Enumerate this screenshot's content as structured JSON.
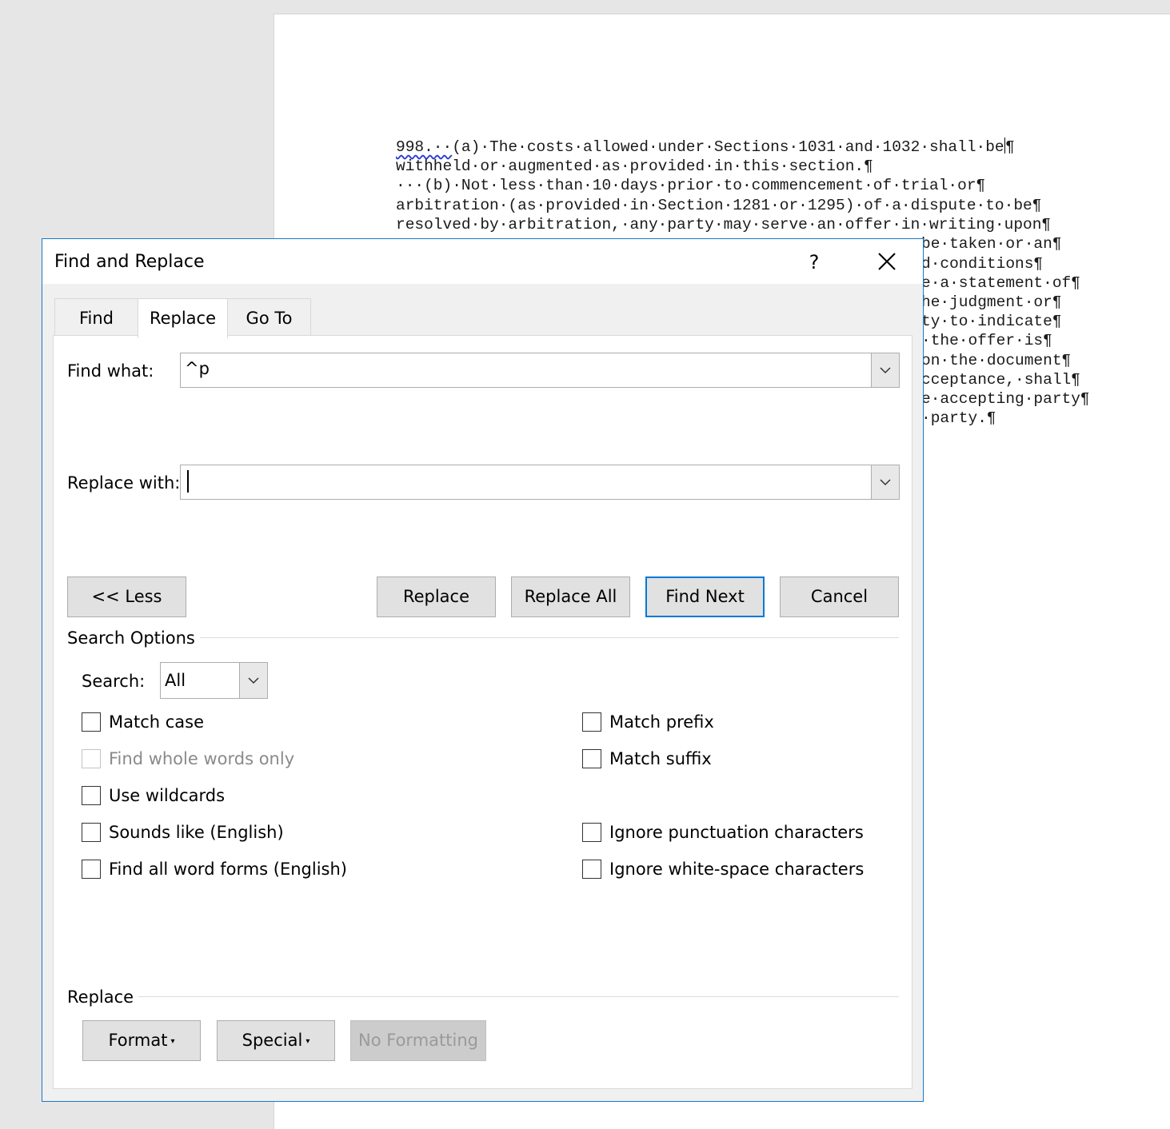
{
  "document": {
    "lines": [
      {
        "pre": "",
        "squiggle": "998.··",
        "post": "(a)·The·costs·allowed·under·Sections·1031·and·1032·shall·be",
        "caret": true,
        "tail": "¶"
      },
      {
        "pre": "withheld·or·augmented·as·provided·in·this·section.¶"
      },
      {
        "pre": "···(b)·Not·less·than·10·days·prior·to·commencement·of·trial·or¶"
      },
      {
        "pre": "arbitration·(as·provided·in·Section·1281·or·1295)·of·a·dispute·to·be¶"
      },
      {
        "pre": "resolved·by·arbitration,·any·party·may·serve·an·offer·in·writing·upon¶"
      },
      {
        "pre": "be·taken·or·an¶"
      },
      {
        "pre": "d·conditions¶"
      },
      {
        "pre": "e·a·statement·of¶"
      },
      {
        "pre": "he·judgment·or¶"
      },
      {
        "pre": "ty·to·indicate¶"
      },
      {
        "pre": "·the·offer·is¶"
      },
      {
        "pre": "on·the·document¶"
      },
      {
        "pre": "cceptance,·shall¶"
      },
      {
        "pre": "e·accepting·party¶"
      },
      {
        "pre": "·party.¶"
      }
    ]
  },
  "dialog": {
    "title": "Find and Replace",
    "help": "?",
    "tabs": {
      "find": "Find",
      "replace": "Replace",
      "goto": "Go To"
    },
    "find_label": "Find what:",
    "find_value": "^p",
    "replace_label": "Replace with:",
    "replace_value": "",
    "buttons": {
      "less": "<< Less",
      "replace": "Replace",
      "replace_all": "Replace All",
      "find_next": "Find Next",
      "cancel": "Cancel"
    },
    "search_options_label": "Search Options",
    "search_label": "Search:",
    "search_value": "All",
    "options_left": [
      {
        "label": "Match case",
        "checked": false,
        "disabled": false
      },
      {
        "label": "Find whole words only",
        "checked": false,
        "disabled": true
      },
      {
        "label": "Use wildcards",
        "checked": false,
        "disabled": false
      },
      {
        "label": "Sounds like (English)",
        "checked": false,
        "disabled": false
      },
      {
        "label": "Find all word forms (English)",
        "checked": false,
        "disabled": false
      }
    ],
    "options_right": [
      {
        "label": "Match prefix",
        "checked": false
      },
      {
        "label": "Match suffix",
        "checked": false
      },
      {
        "label": "Ignore punctuation characters",
        "checked": false
      },
      {
        "label": "Ignore white-space characters",
        "checked": false
      }
    ],
    "replace_section_label": "Replace",
    "format_button": "Format",
    "special_button": "Special",
    "no_formatting_button": "No Formatting"
  }
}
